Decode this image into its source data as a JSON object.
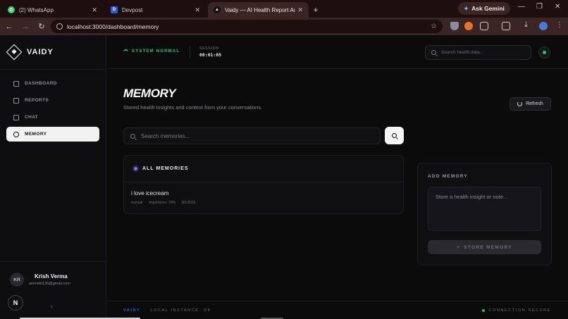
{
  "browser": {
    "tabs": [
      {
        "title": "(2) WhatsApp",
        "icon": "whatsapp-icon",
        "color": "#25d366"
      },
      {
        "title": "Devpost",
        "icon": "devpost-icon",
        "color": "#2b5bd7"
      },
      {
        "title": "Vaidy — AI Health Report Analy",
        "icon": "vaidy-icon",
        "color": "#ffffff"
      }
    ],
    "gemini_label": "Ask Gemini",
    "url": "localhost:3000/dashboard/memory"
  },
  "sidebar": {
    "brand": "VAIDY",
    "items": [
      {
        "label": "DASHBOARD",
        "icon": "grid-icon"
      },
      {
        "label": "REPORTS",
        "icon": "document-icon"
      },
      {
        "label": "CHAT",
        "icon": "chat-icon"
      },
      {
        "label": "MEMORY",
        "icon": "brain-icon",
        "active": true
      }
    ],
    "user": {
      "initials": "KR",
      "name": "Krish Verma",
      "email": "animelit136@gmail.com"
    },
    "badge": "N",
    "collapse": "‹"
  },
  "header": {
    "status": "SYSTEM NORMAL",
    "session_label": "SESSION",
    "session_time": "00:01:05",
    "search_placeholder": "Search health data..."
  },
  "main": {
    "title": "MEMORY",
    "subtitle": "Stored health insights and context from your conversations.",
    "refresh_label": "Refresh",
    "search_placeholder": "Search memories...",
    "panel_title": "ALL MEMORIES",
    "memories": [
      {
        "text": "i love icecream",
        "source": "manual",
        "importance": "importance: 70%",
        "date": "8/1/2026"
      }
    ],
    "add": {
      "label": "ADD MEMORY",
      "placeholder": "Store a health insight or note...",
      "button": "STORE MEMORY"
    }
  },
  "footer": {
    "brand": "VAIDY",
    "instance": "LOCAL INSTANCE: OK",
    "connection": "CONNECTION SECURE"
  },
  "colors": {
    "accent_green": "#22c27a",
    "accent_purple": "#7c6cf2",
    "footer_brand": "#3f5fd8"
  }
}
